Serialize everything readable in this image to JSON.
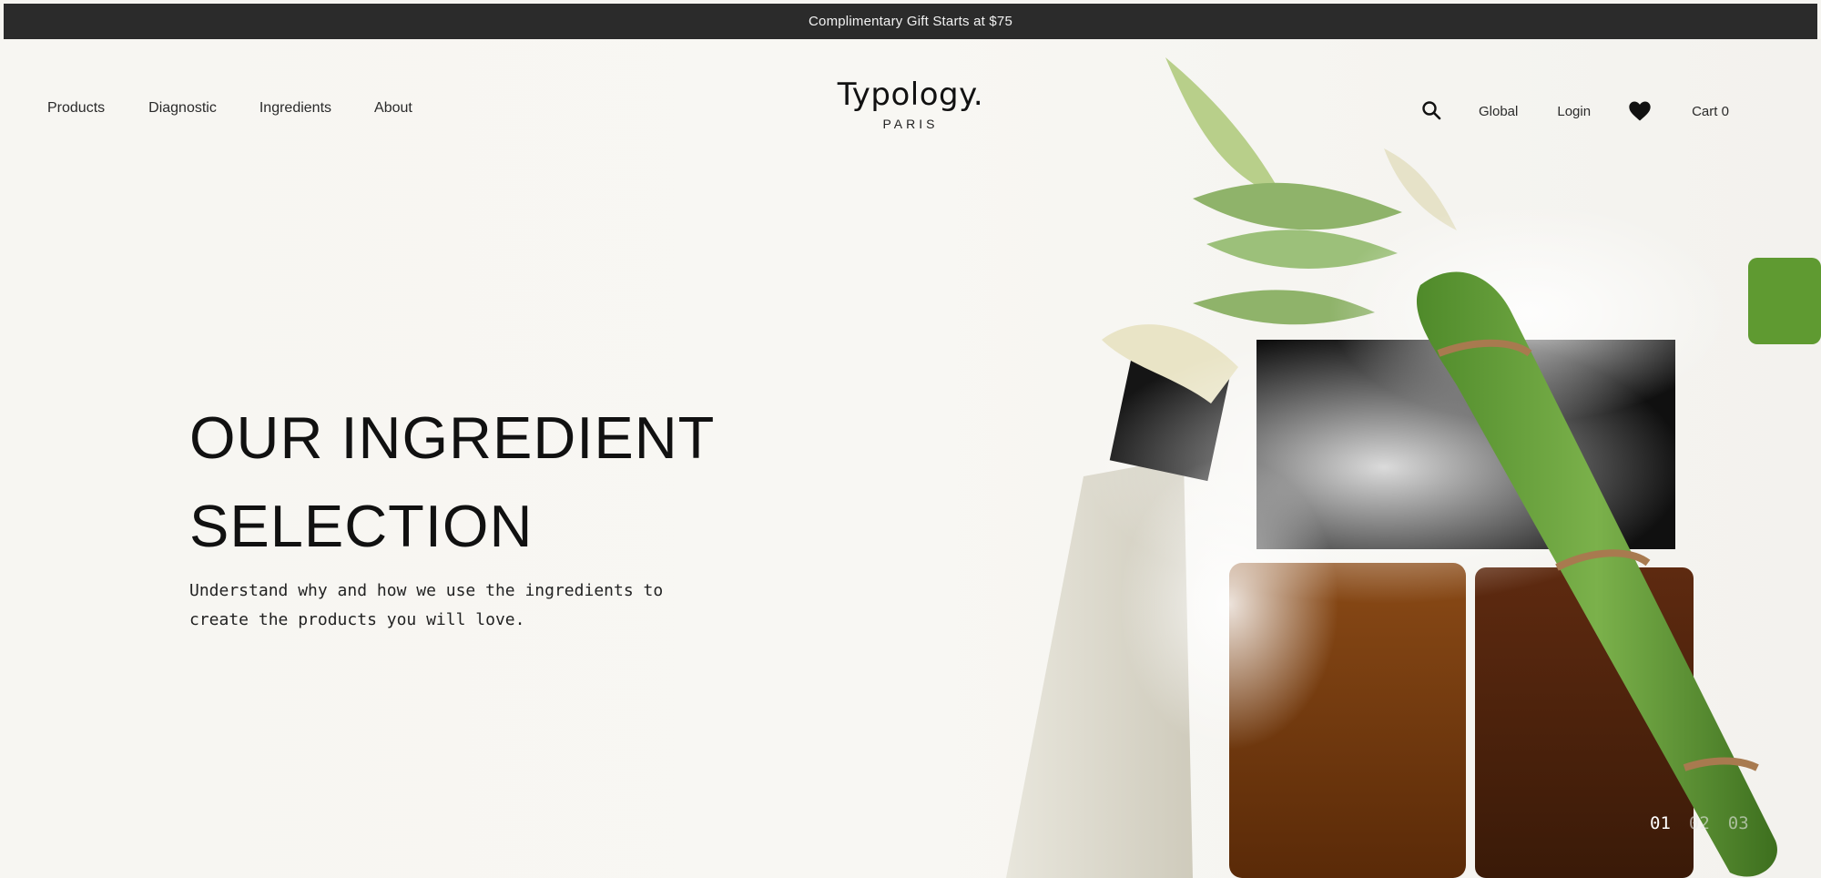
{
  "announcement": {
    "text": "Complimentary Gift Starts at $75"
  },
  "nav": {
    "left": [
      "Products",
      "Diagnostic",
      "Ingredients",
      "About"
    ],
    "right": {
      "global": "Global",
      "login": "Login",
      "cart": "Cart 0"
    }
  },
  "logo": {
    "name": "Typology.",
    "sub": "PARIS"
  },
  "hero": {
    "title_line1": "OUR INGREDIENT",
    "title_line2": "SELECTION",
    "subtitle_line1": "Understand why and how we use the ingredients to",
    "subtitle_line2": "create the products you will love."
  },
  "slides": {
    "items": [
      "01",
      "02",
      "03"
    ],
    "active": "01"
  },
  "icons": {
    "search": "search-icon",
    "wishlist": "heart-icon"
  },
  "colors": {
    "announcement_bg": "#2b2b2b",
    "background": "#f6f5f1",
    "text": "#111111"
  }
}
